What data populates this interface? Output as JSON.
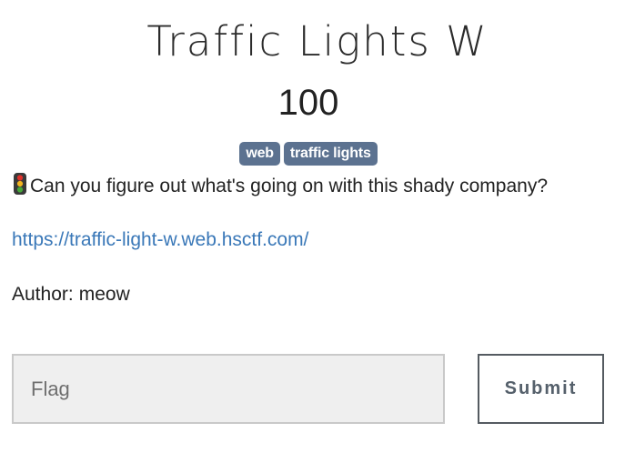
{
  "challenge": {
    "title": "Traffic Lights W",
    "points": "100",
    "tags": [
      {
        "label": "web"
      },
      {
        "label": "traffic lights"
      }
    ],
    "description": "Can you figure out what's going on with this shady company?",
    "description_icon": "traffic-light-icon",
    "link": "https://traffic-light-w.web.hsctf.com/",
    "author_label": "Author:",
    "author_name": "meow"
  },
  "form": {
    "flag_placeholder": "Flag",
    "flag_value": "",
    "submit_label": "Submit"
  },
  "colors": {
    "tag_background": "#5c7290",
    "link": "#3a78b8",
    "input_background": "#efefef",
    "submit_border": "#555b61"
  }
}
